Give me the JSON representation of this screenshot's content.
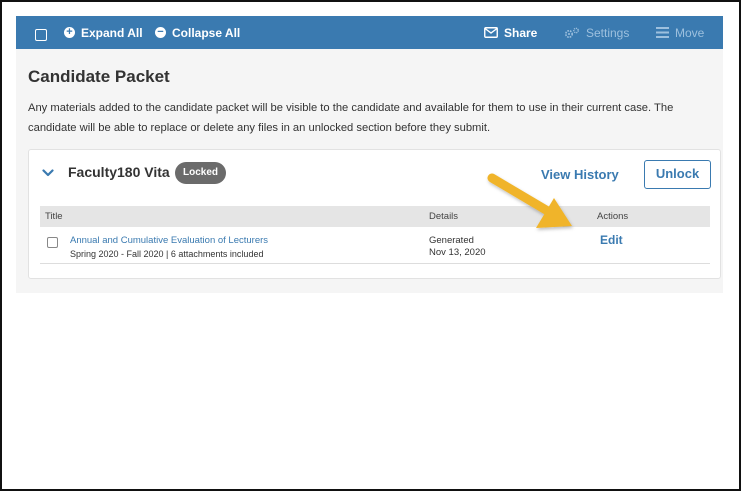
{
  "toolbar": {
    "expand_all": "Expand All",
    "collapse_all": "Collapse All",
    "share": "Share",
    "settings": "Settings",
    "move": "Move"
  },
  "page": {
    "title": "Candidate Packet",
    "description": "Any materials added to the candidate packet will be visible to the candidate and available for them to use in their current case. The candidate will be able to replace or delete any files in an unlocked section before they submit."
  },
  "section": {
    "title": "Faculty180 Vita",
    "status_badge": "Locked",
    "view_history": "View History",
    "unlock": "Unlock",
    "columns": {
      "title": "Title",
      "details": "Details",
      "actions": "Actions"
    },
    "rows": [
      {
        "title": "Annual and Cumulative Evaluation of Lecturers",
        "subtitle": "Spring 2020 - Fall 2020 | 6 attachments included",
        "detail_line1": "Generated",
        "detail_line2": "Nov 13, 2020",
        "action": "Edit"
      }
    ]
  },
  "colors": {
    "toolbar_bg": "#3a7ab0",
    "link": "#3a7ab0",
    "badge_bg": "#6b6b6b",
    "arrow": "#f0b429"
  }
}
